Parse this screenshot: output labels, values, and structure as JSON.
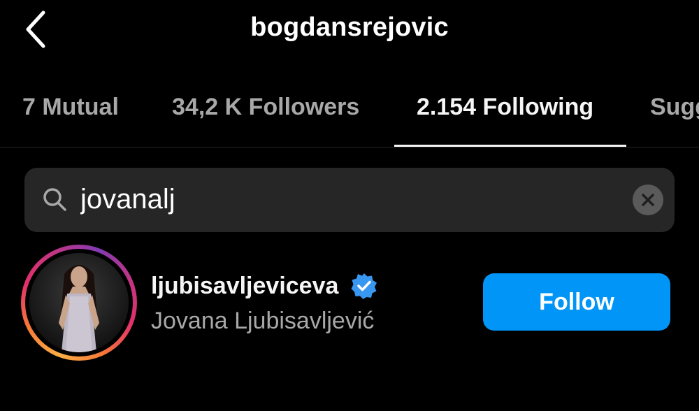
{
  "header": {
    "title": "bogdansrejovic",
    "back_icon": "chevron-left-icon"
  },
  "tabs": [
    {
      "label": "7 Mutual",
      "active": false
    },
    {
      "label": "34,2 K Followers",
      "active": false
    },
    {
      "label": "2.154 Following",
      "active": true
    },
    {
      "label": "Sugg",
      "active": false
    }
  ],
  "search": {
    "value": "jovanalj",
    "icon": "search-icon",
    "clear_icon": "clear-icon"
  },
  "results": [
    {
      "username": "ljubisavljeviceva",
      "full_name": "Jovana Ljubisavljević",
      "verified": true,
      "action_label": "Follow"
    }
  ],
  "colors": {
    "background": "#000000",
    "search_bg": "#262626",
    "secondary_text": "#a8a8a8",
    "follow_button": "#0095f6",
    "verified_badge": "#3897f0"
  }
}
